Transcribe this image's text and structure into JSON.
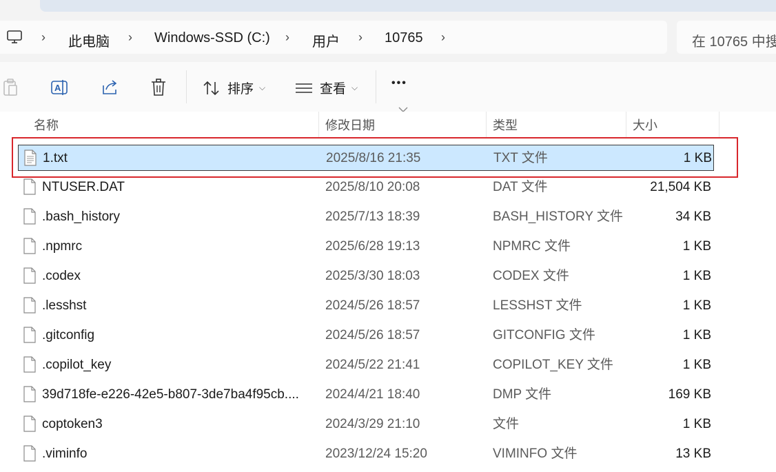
{
  "address": {
    "crumbs": [
      "此电脑",
      "Windows-SSD (C:)",
      "用户",
      "10765"
    ],
    "search_placeholder": "在 10765 中搜"
  },
  "toolbar": {
    "sort_label": "排序",
    "view_label": "查看",
    "more_label": "•••"
  },
  "columns": {
    "name": "名称",
    "date": "修改日期",
    "type": "类型",
    "size": "大小"
  },
  "files": [
    {
      "name": "1.txt",
      "date": "2025/8/16 21:35",
      "type": "TXT 文件",
      "size": "1 KB",
      "selected": true
    },
    {
      "name": "NTUSER.DAT",
      "date": "2025/8/10 20:08",
      "type": "DAT 文件",
      "size": "21,504 KB"
    },
    {
      "name": ".bash_history",
      "date": "2025/7/13 18:39",
      "type": "BASH_HISTORY 文件",
      "size": "34 KB"
    },
    {
      "name": ".npmrc",
      "date": "2025/6/28 19:13",
      "type": "NPMRC 文件",
      "size": "1 KB"
    },
    {
      "name": ".codex",
      "date": "2025/3/30 18:03",
      "type": "CODEX 文件",
      "size": "1 KB"
    },
    {
      "name": ".lesshst",
      "date": "2024/5/26 18:57",
      "type": "LESSHST 文件",
      "size": "1 KB"
    },
    {
      "name": ".gitconfig",
      "date": "2024/5/26 18:57",
      "type": "GITCONFIG 文件",
      "size": "1 KB"
    },
    {
      "name": ".copilot_key",
      "date": "2024/5/22 21:41",
      "type": "COPILOT_KEY 文件",
      "size": "1 KB"
    },
    {
      "name": "39d718fe-e226-42e5-b807-3de7ba4f95cb....",
      "date": "2024/4/21 18:40",
      "type": "DMP 文件",
      "size": "169 KB"
    },
    {
      "name": "coptoken3",
      "date": "2024/3/29 21:10",
      "type": "文件",
      "size": "1 KB"
    },
    {
      "name": ".viminfo",
      "date": "2023/12/24 15:20",
      "type": "VIMINFO 文件",
      "size": "13 KB"
    }
  ],
  "colors": {
    "selection": "#cce8ff",
    "highlight_border": "#d8262b",
    "accent": "#1d6fc9"
  }
}
